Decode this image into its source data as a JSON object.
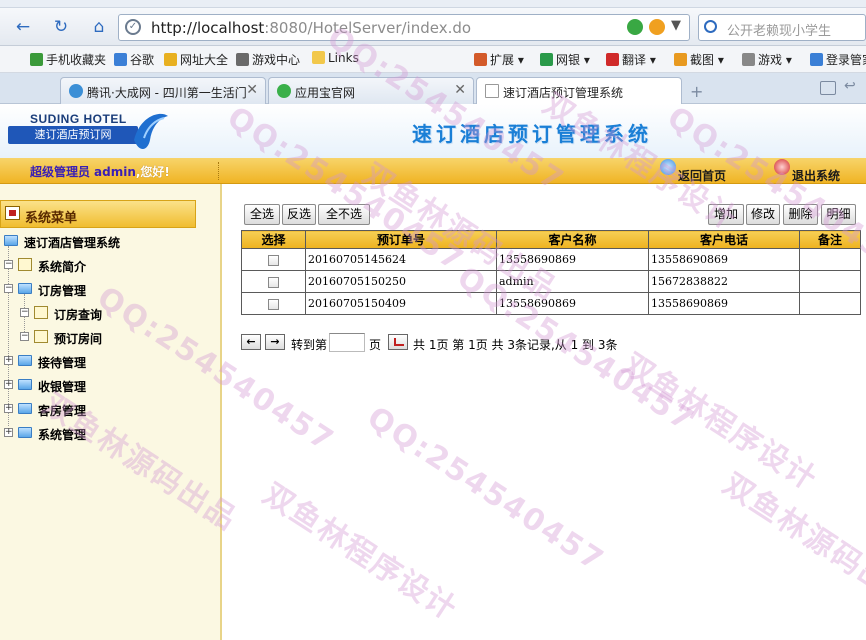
{
  "browser": {
    "url_host": "http://localhost",
    "url_rest": ":8080/HotelServer/index.do",
    "search_placeholder": "公开老赖现小学生",
    "favorites": [
      "手机收藏夹",
      "谷歌",
      "网址大全",
      "游戏中心",
      "Links"
    ],
    "toolbar": [
      "扩展",
      "网银",
      "翻译",
      "截图",
      "游戏",
      "登录管家"
    ],
    "tabs": [
      {
        "title": "腾讯·大成网 - 四川第一生活门",
        "active": false
      },
      {
        "title": "应用宝官网",
        "active": false
      },
      {
        "title": "速订酒店预订管理系统",
        "active": true
      }
    ]
  },
  "header": {
    "logo_en": "SUDING HOTEL",
    "logo_cn": "速订酒店预订网",
    "title": "速订酒店预订管理系统"
  },
  "userbar": {
    "role": "超级管理员",
    "username": "admin",
    "greeting": ",您好!",
    "home_link": "返回首页",
    "logout_link": "退出系统"
  },
  "sidebar": {
    "menu_title": "系统菜单",
    "root": "速订酒店管理系统",
    "items": [
      {
        "label": "系统简介",
        "level": 1,
        "type": "page"
      },
      {
        "label": "订房管理",
        "level": 1,
        "type": "folder",
        "expanded": true
      },
      {
        "label": "订房查询",
        "level": 2,
        "type": "page"
      },
      {
        "label": "预订房间",
        "level": 2,
        "type": "page"
      },
      {
        "label": "接待管理",
        "level": 1,
        "type": "folder"
      },
      {
        "label": "收银管理",
        "level": 1,
        "type": "folder"
      },
      {
        "label": "客房管理",
        "level": 1,
        "type": "folder"
      },
      {
        "label": "系统管理",
        "level": 1,
        "type": "folder"
      }
    ]
  },
  "toolbar": {
    "select_all": "全选",
    "invert": "反选",
    "select_none": "全不选",
    "add": "增加",
    "edit": "修改",
    "delete": "删除",
    "detail": "明细"
  },
  "table": {
    "headers": [
      "选择",
      "预订单号",
      "客户名称",
      "客户电话",
      "备注"
    ],
    "rows": [
      {
        "order": "20160705145624",
        "name": "13558690869",
        "phone": "13558690869",
        "note": ""
      },
      {
        "order": "20160705150250",
        "name": "admin",
        "phone": "15672838822",
        "note": ""
      },
      {
        "order": "20160705150409",
        "name": "13558690869",
        "phone": "13558690869",
        "note": ""
      }
    ]
  },
  "pager": {
    "goto_prefix": "转到第",
    "goto_suffix": "页",
    "summary": "共 1页 第 1页 共 3条记录,从 1 到 3条"
  },
  "watermark": {
    "qq": "QQ:254540457",
    "name1": "双鱼林程序设计",
    "name2": "双鱼林源码出品"
  },
  "colors": {
    "title_blue": "#1a7fd6",
    "userbar_gold": "#f0b424",
    "header_gold": "#eeb21f",
    "sidebar_bg": "#fbf8e2"
  }
}
